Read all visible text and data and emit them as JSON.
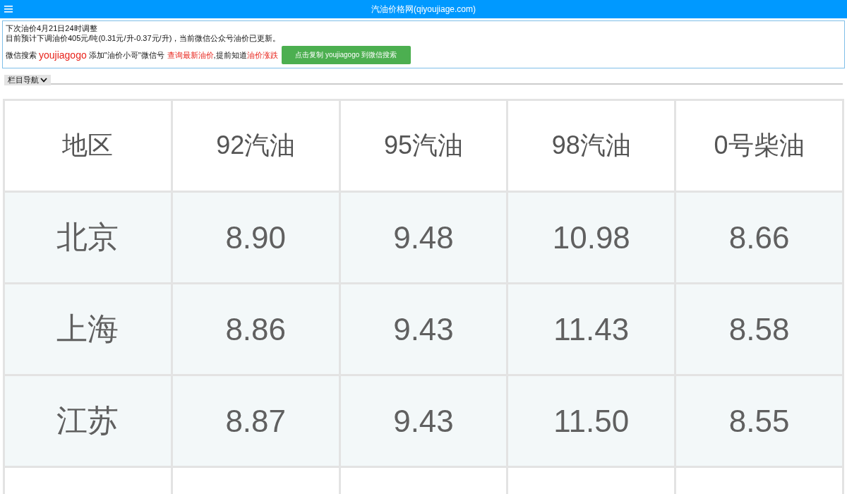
{
  "top_bar": {
    "title": "汽油价格网(qiyoujiage.com)"
  },
  "notice": {
    "line_1": "下次油价4月21日24时调整",
    "line_2": "目前预计下调油价405元/吨(0.31元/升-0.37元/升)，当前微信公众号油价已更新。",
    "promo_prefix": "微信搜索",
    "wechat_id": "youjiagogo",
    "promo_middle": "添加\"油价小哥\"微信号",
    "link_1": "查询最新油价",
    "promo_after": ",提前知道",
    "link_2": "油价涨跌",
    "copy_button": "点击复制 youjiagogo 到微信搜索"
  },
  "nav_toggle": {
    "label": "栏目导航",
    "expanded": false
  },
  "table": {
    "columns": [
      "地区",
      "92汽油",
      "95汽油",
      "98汽油",
      "0号柴油"
    ],
    "rows": [
      {
        "region": "北京",
        "values": [
          "8.90",
          "9.48",
          "10.98",
          "8.66"
        ]
      },
      {
        "region": "上海",
        "values": [
          "8.86",
          "9.43",
          "11.43",
          "8.58"
        ]
      },
      {
        "region": "江苏",
        "values": [
          "8.87",
          "9.43",
          "11.50",
          "8.55"
        ]
      }
    ]
  }
}
